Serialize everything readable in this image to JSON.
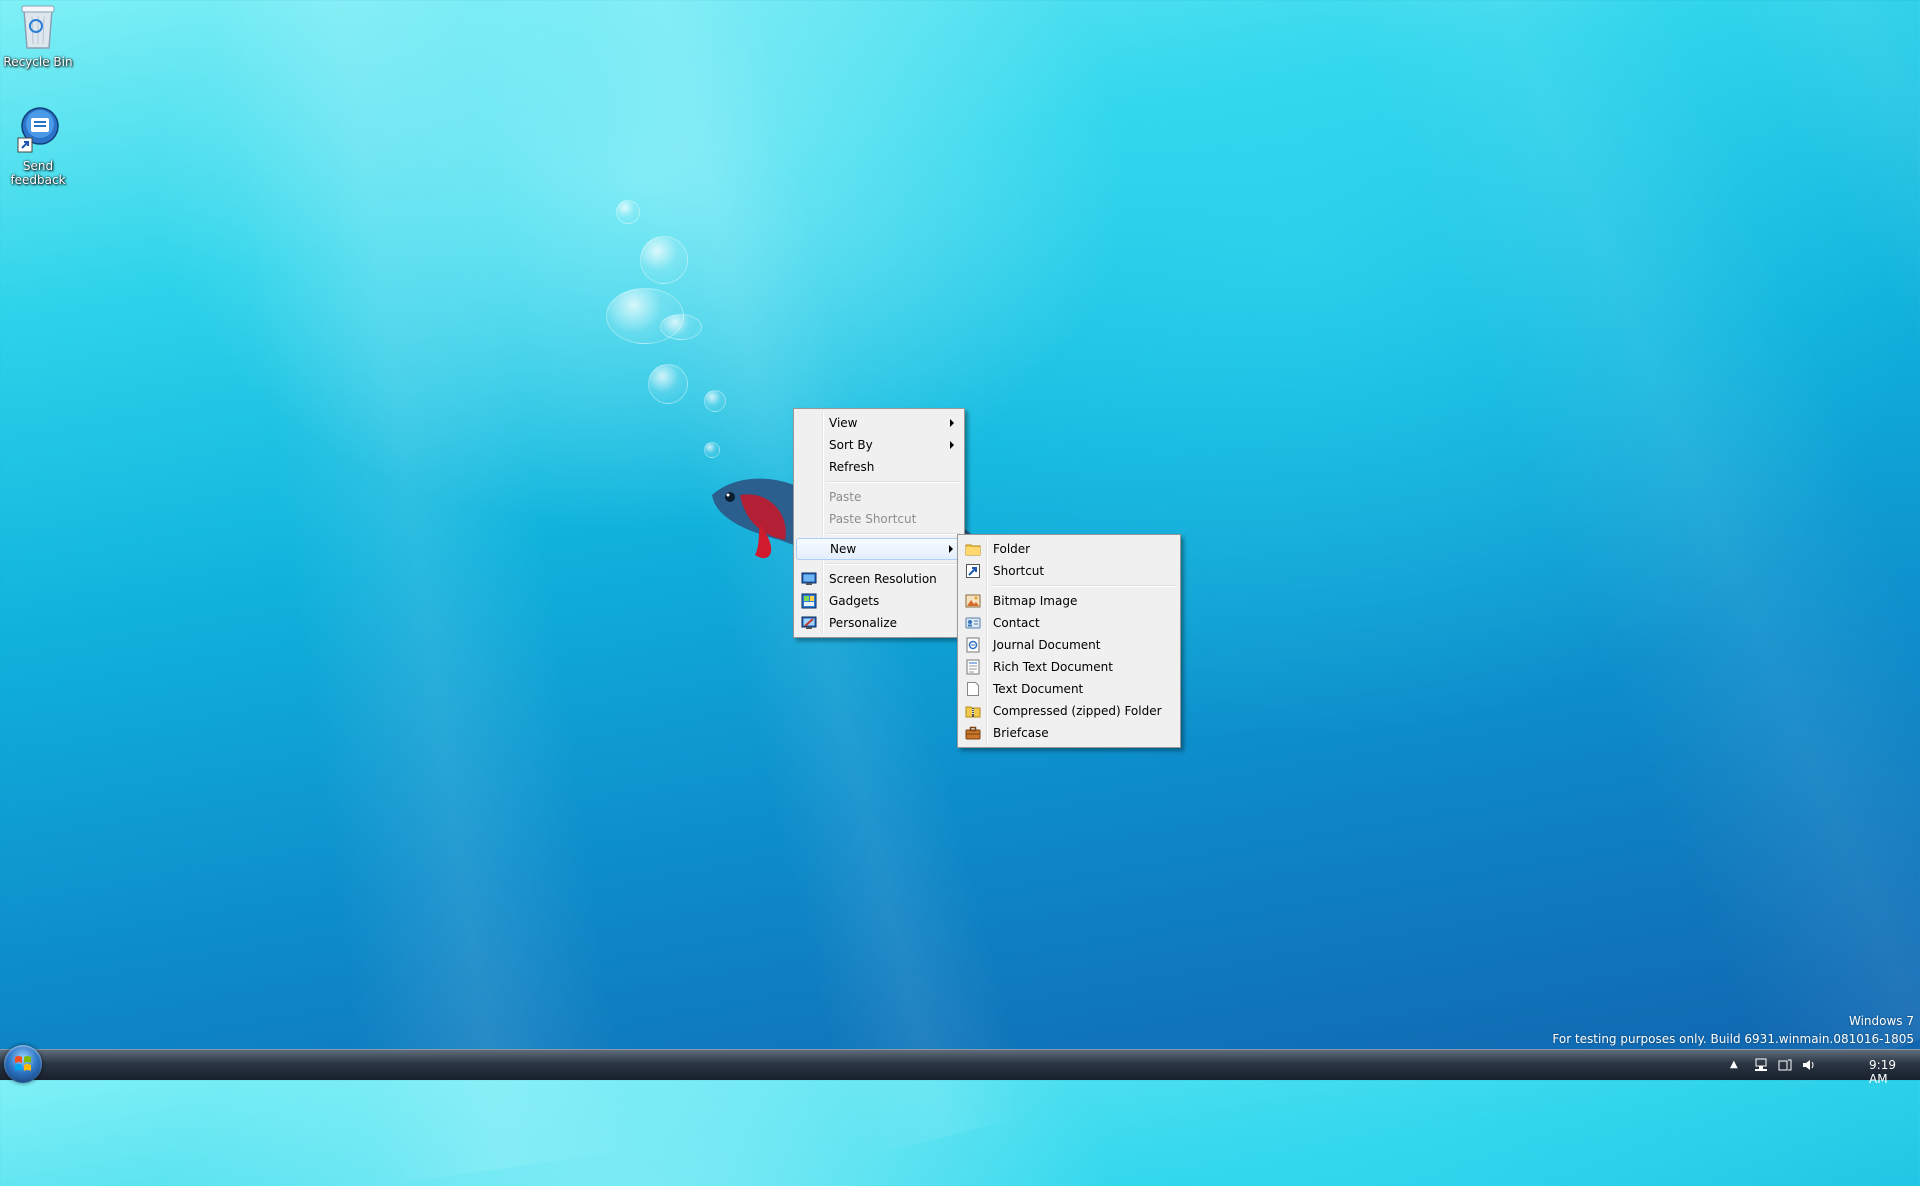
{
  "desktop": {
    "icons": [
      {
        "label": "Recycle Bin",
        "icon": "recycle-bin-icon"
      },
      {
        "label": "Send feedback",
        "icon": "feedback-icon"
      }
    ]
  },
  "context_menu": {
    "items": [
      {
        "label": "View",
        "submenu": true
      },
      {
        "label": "Sort By",
        "submenu": true
      },
      {
        "label": "Refresh"
      },
      {
        "label": "Paste",
        "disabled": true
      },
      {
        "label": "Paste Shortcut",
        "disabled": true
      },
      {
        "label": "New",
        "submenu": true,
        "highlighted": true
      },
      {
        "label": "Screen Resolution",
        "icon": "screen-resolution-icon"
      },
      {
        "label": "Gadgets",
        "icon": "gadgets-icon"
      },
      {
        "label": "Personalize",
        "icon": "personalize-icon"
      }
    ]
  },
  "new_submenu": {
    "items": [
      {
        "label": "Folder",
        "icon": "folder-icon"
      },
      {
        "label": "Shortcut",
        "icon": "shortcut-icon"
      },
      {
        "label": "Bitmap Image",
        "icon": "bitmap-image-icon"
      },
      {
        "label": "Contact",
        "icon": "contact-icon"
      },
      {
        "label": "Journal Document",
        "icon": "journal-document-icon"
      },
      {
        "label": "Rich Text Document",
        "icon": "rich-text-document-icon"
      },
      {
        "label": "Text Document",
        "icon": "text-document-icon"
      },
      {
        "label": "Compressed (zipped) Folder",
        "icon": "zip-folder-icon"
      },
      {
        "label": "Briefcase",
        "icon": "briefcase-icon"
      }
    ]
  },
  "watermark": {
    "line1": "Windows 7",
    "line2": "For testing purposes only. Build 6931.winmain.081016-1805"
  },
  "taskbar": {
    "clock": "9:19 AM"
  },
  "colors": {
    "menu_bg": "#f0f0f0",
    "menu_border": "#979797",
    "highlight": "#e4eefc",
    "taskbar": "#1f2a37"
  }
}
